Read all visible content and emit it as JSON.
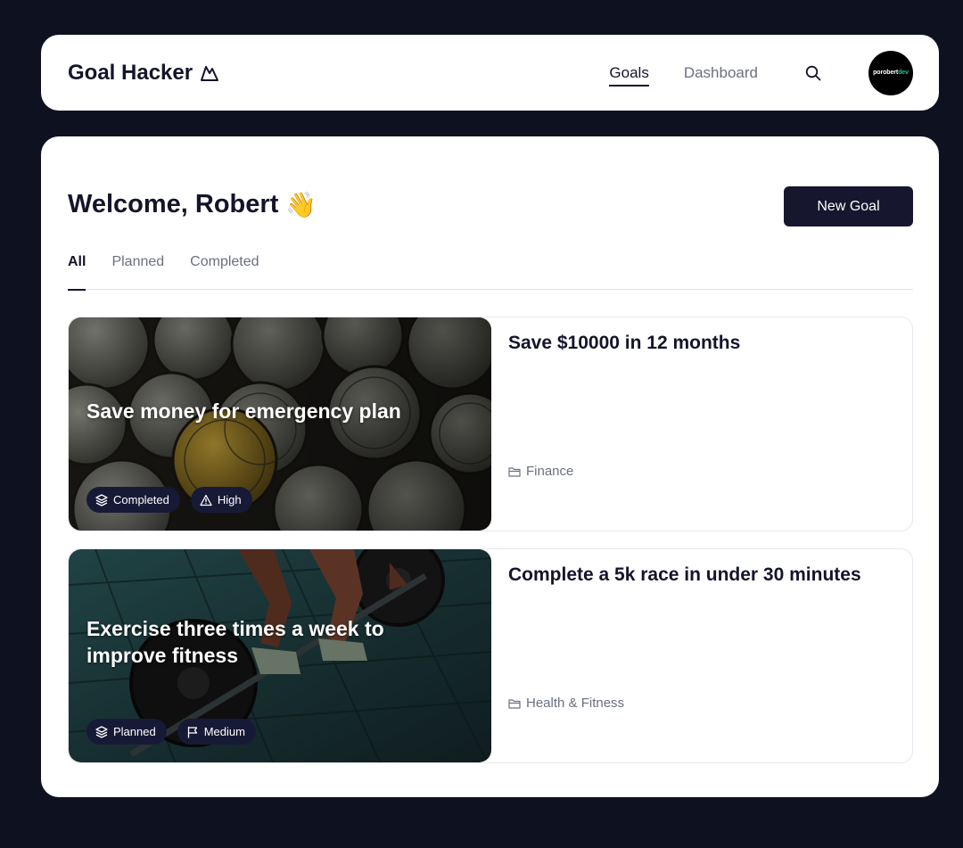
{
  "colors": {
    "background": "#0e1220",
    "primary": "#16162e",
    "badge": "#171a36",
    "muted": "#6b7080"
  },
  "header": {
    "brand": "Goal Hacker",
    "brand_icon": "mountain-icon",
    "nav": [
      {
        "label": "Goals",
        "active": true
      },
      {
        "label": "Dashboard",
        "active": false
      }
    ],
    "search_icon": "search-icon",
    "avatar": {
      "text_white": "porobert",
      "text_green": "dev"
    }
  },
  "main": {
    "welcome": "Welcome, Robert",
    "welcome_emoji": "👋",
    "new_goal_label": "New Goal",
    "tabs": [
      {
        "label": "All",
        "active": true
      },
      {
        "label": "Planned",
        "active": false
      },
      {
        "label": "Completed",
        "active": false
      }
    ],
    "goals": [
      {
        "overlay_title": "Save money for emergency plan",
        "title": "Save $10000 in 12 months",
        "category": "Finance",
        "category_icon": "folder-icon",
        "status": "Completed",
        "status_icon": "layers-icon",
        "priority": "High",
        "priority_icon": "alert-triangle-icon"
      },
      {
        "overlay_title": "Exercise three times a week to improve fitness",
        "title": "Complete a 5k race in under 30 minutes",
        "category": "Health & Fitness",
        "category_icon": "folder-icon",
        "status": "Planned",
        "status_icon": "layers-icon",
        "priority": "Medium",
        "priority_icon": "flag-icon"
      }
    ]
  }
}
